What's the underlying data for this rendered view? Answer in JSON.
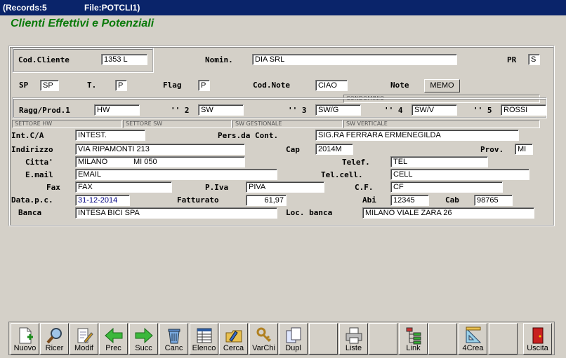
{
  "window": {
    "records": "(Records:5",
    "file": "File:POTCLI1)"
  },
  "form_title": "Clienti Effettivi e Potenziali",
  "row1": {
    "cod_cliente_label": "Cod.Cliente",
    "cod_cliente": "1353 L",
    "nomin_label": "Nomin.",
    "nomin": "DIA SRL",
    "pr_label": "PR",
    "pr": "S"
  },
  "row2": {
    "sp_label": "SP",
    "sp": "SP",
    "t_label": "T.",
    "t": "P",
    "flag_label": "Flag",
    "flag": "P",
    "codnote_label": "Cod.Note",
    "codnote": "CIAO",
    "note_label": "Note",
    "memo_label": "MEMO"
  },
  "ragg": {
    "condominio": "CONDOMINIO",
    "label1": "Ragg/Prod.1",
    "v1": "HW",
    "label2": "'' 2",
    "v2": "SW",
    "label3": "'' 3",
    "v3": "SW/G",
    "label4": "'' 4",
    "v4": "SW/V",
    "label5": "'' 5",
    "v5": "ROSSI",
    "sub1": "SETTORE HW",
    "sub2": "SETTORE SW",
    "sub3": "SW GESTIONALE",
    "sub4": "SW VERTICALE"
  },
  "details": {
    "intca_label": "Int.C/A",
    "intca": "INTEST.",
    "pers_label": "Pers.da Cont.",
    "pers": "SIG.RA FERRARA ERMENEGILDA",
    "indirizzo_label": "Indirizzo",
    "indirizzo": "VIA RIPAMONTI 213",
    "cap_label": "Cap",
    "cap": "2014M",
    "prov_label": "Prov.",
    "prov": "MI",
    "citta_label": "Citta'",
    "citta": "MILANO",
    "citta_code": "MI 050",
    "telef_label": "Telef.",
    "telef": "TEL",
    "email_label": "E.mail",
    "email": "EMAIL",
    "telcell_label": "Tel.cell.",
    "telcell": "CELL",
    "fax_label": "Fax",
    "fax": "FAX",
    "piva_label": "P.Iva",
    "piva": "PIVA",
    "cf_label": "C.F.",
    "cf": "CF",
    "datapc_label": "Data.p.c.",
    "datapc": "31-12-2014",
    "fatturato_label": "Fatturato",
    "fatturato": "61,97",
    "abi_label": "Abi",
    "abi": "12345",
    "cab_label": "Cab",
    "cab": "98765",
    "banca_label": "Banca",
    "banca": "INTESA BICI SPA",
    "locbanca_label": "Loc. banca",
    "locbanca": "MILANO VIALE ZARA 26"
  },
  "toolbar": [
    {
      "label": "Nuovo",
      "icon": "new-document-icon"
    },
    {
      "label": "Ricer",
      "icon": "magnifier-icon"
    },
    {
      "label": "Modif",
      "icon": "edit-document-icon"
    },
    {
      "label": "Prec",
      "icon": "arrow-left-icon"
    },
    {
      "label": "Succ",
      "icon": "arrow-right-icon"
    },
    {
      "label": "Canc",
      "icon": "trash-icon"
    },
    {
      "label": "Elenco",
      "icon": "table-list-icon"
    },
    {
      "label": "Cerca",
      "icon": "search-folder-icon"
    },
    {
      "label": "VarChi",
      "icon": "keys-icon"
    },
    {
      "label": "Dupl",
      "icon": "duplicate-icon"
    },
    {
      "label": "Liste",
      "icon": "printer-icon"
    },
    {
      "label": "Link",
      "icon": "link-tree-icon"
    },
    {
      "label": "4Crea",
      "icon": "ruler-triangle-icon"
    },
    {
      "label": "Uscita",
      "icon": "exit-door-icon"
    }
  ],
  "colors": {
    "title_green": "#0b7a0b",
    "titlebar": "#0a246a",
    "background": "#d4d0c8"
  }
}
